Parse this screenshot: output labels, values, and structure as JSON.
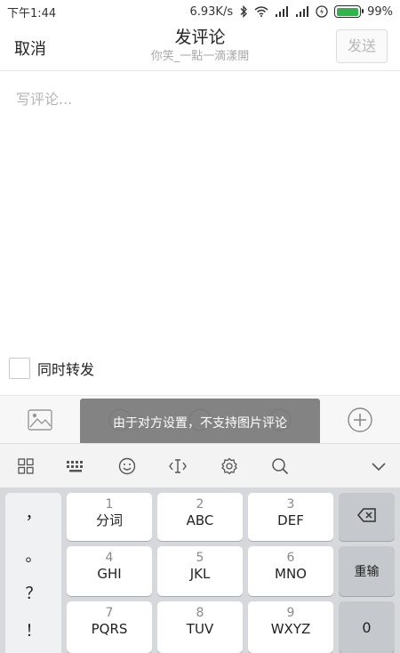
{
  "status_bar": {
    "time": "下午1:44",
    "speed": "6.93K/s",
    "battery": "99%",
    "battery_level": 0.99
  },
  "header": {
    "cancel_label": "取消",
    "title": "发评论",
    "subtitle": "你笑_一點一滴漾開",
    "send_label": "发送"
  },
  "compose": {
    "placeholder": "写评论..."
  },
  "repost": {
    "label": "同时转发",
    "checked": false
  },
  "toast": {
    "message": "由于对方设置，不支持图片评论"
  },
  "keyboard": {
    "punctuation": [
      "，",
      "。",
      "？",
      "！"
    ],
    "keys": [
      {
        "num": "1",
        "label": "分词"
      },
      {
        "num": "2",
        "label": "ABC"
      },
      {
        "num": "3",
        "label": "DEF"
      },
      {
        "num": "4",
        "label": "GHI"
      },
      {
        "num": "5",
        "label": "JKL"
      },
      {
        "num": "6",
        "label": "MNO"
      },
      {
        "num": "7",
        "label": "PQRS"
      },
      {
        "num": "8",
        "label": "TUV"
      },
      {
        "num": "9",
        "label": "WXYZ"
      }
    ],
    "retype_label": "重输",
    "zero_label": "0"
  },
  "colors": {
    "accent_battery": "#2fb34a",
    "toast_bg": "#787878",
    "keyboard_bg": "#d6d8dc"
  }
}
